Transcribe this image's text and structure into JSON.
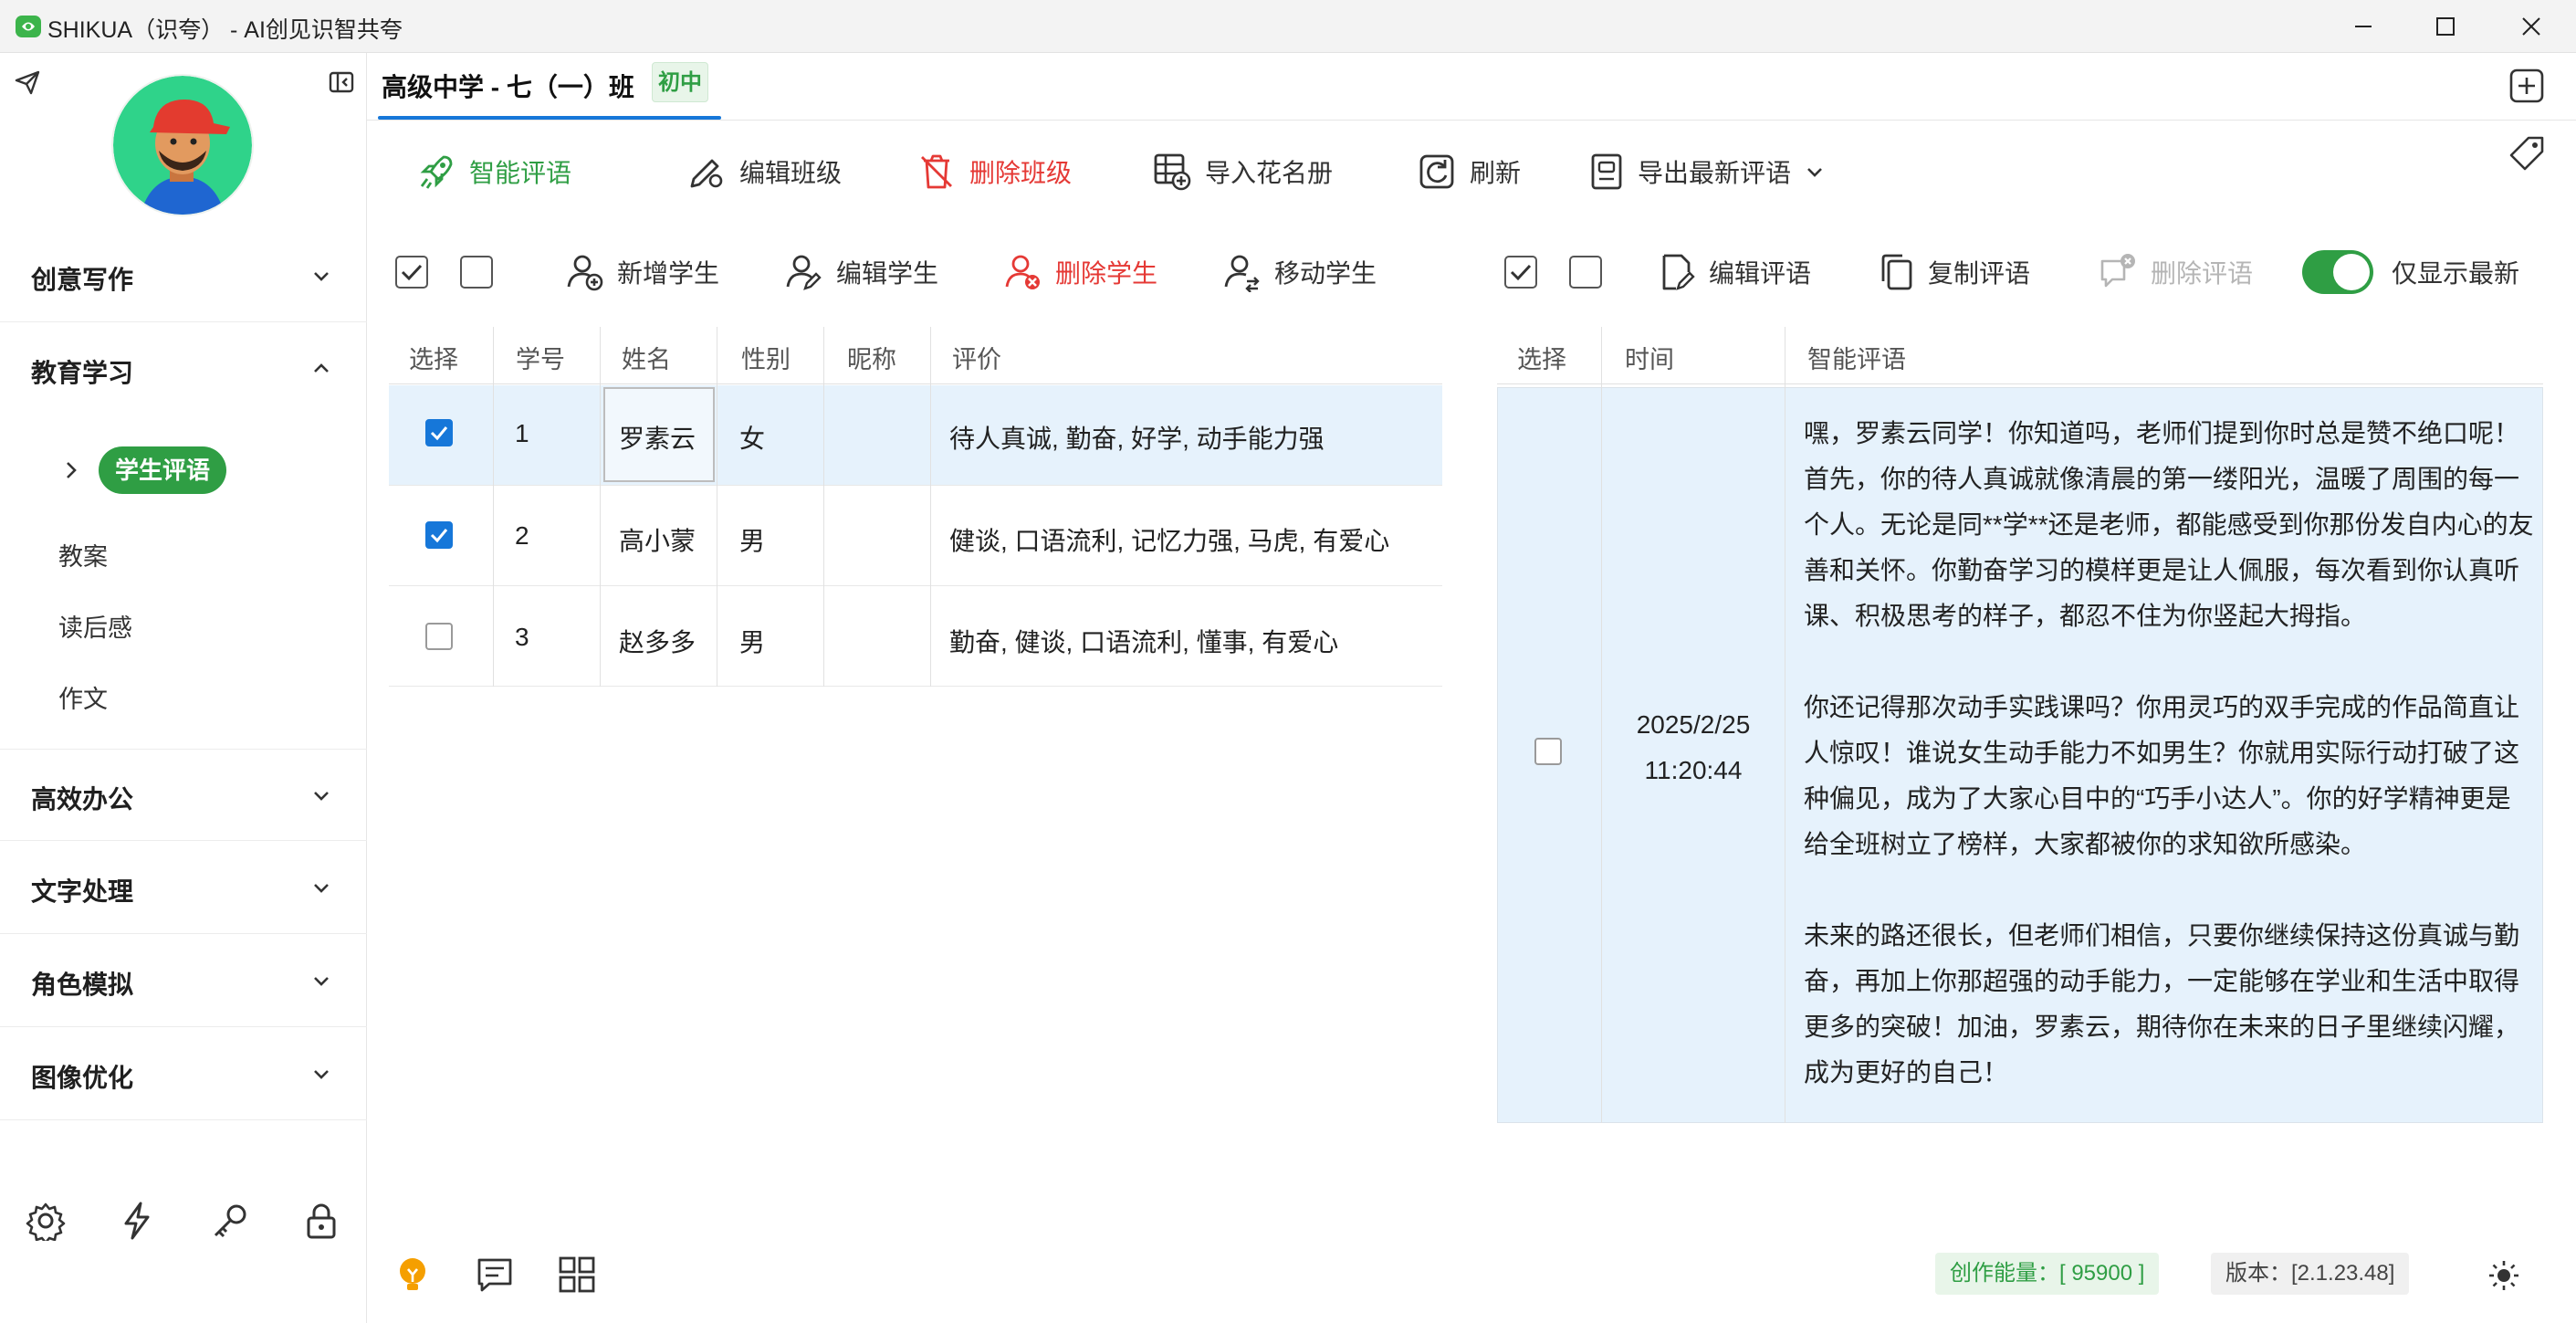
{
  "window": {
    "title": "SHIKUA（识夸） - AI创见识智共夸"
  },
  "sidebar": {
    "groups": [
      {
        "label": "创意写作",
        "expanded": false
      },
      {
        "label": "教育学习",
        "expanded": true
      },
      {
        "label": "高效办公",
        "expanded": false
      },
      {
        "label": "文字处理",
        "expanded": false
      },
      {
        "label": "角色模拟",
        "expanded": false
      },
      {
        "label": "图像优化",
        "expanded": false
      }
    ],
    "active_sub": "学生评语",
    "sub_items": [
      "教案",
      "读后感",
      "作文"
    ]
  },
  "tab": {
    "title": "高级中学 - 七（一）班",
    "badge": "初中"
  },
  "toolbar": {
    "smart_comment": "智能评语",
    "edit_class": "编辑班级",
    "delete_class": "删除班级",
    "import_roster": "导入花名册",
    "refresh": "刷新",
    "export_latest": "导出最新评语"
  },
  "student_toolbar": {
    "add": "新增学生",
    "edit": "编辑学生",
    "delete": "删除学生",
    "move": "移动学生"
  },
  "comment_toolbar": {
    "edit": "编辑评语",
    "copy": "复制评语",
    "delete": "删除评语",
    "latest_only": "仅显示最新",
    "latest_only_on": true
  },
  "students_table": {
    "headers": [
      "选择",
      "学号",
      "姓名",
      "性别",
      "昵称",
      "评价"
    ],
    "rows": [
      {
        "selected": true,
        "id": "1",
        "name": "罗素云",
        "gender": "女",
        "nickname": "",
        "eval": "待人真诚, 勤奋, 好学, 动手能力强"
      },
      {
        "selected": true,
        "id": "2",
        "name": "高小蒙",
        "gender": "男",
        "nickname": "",
        "eval": "健谈, 口语流利, 记忆力强, 马虎, 有爱心"
      },
      {
        "selected": false,
        "id": "3",
        "name": "赵多多",
        "gender": "男",
        "nickname": "",
        "eval": "勤奋, 健谈, 口语流利, 懂事, 有爱心"
      }
    ]
  },
  "comments_table": {
    "headers": [
      "选择",
      "时间",
      "智能评语"
    ],
    "rows": [
      {
        "selected": false,
        "date": "2025/2/25",
        "time": "11:20:44",
        "paragraphs": [
          "嘿，罗素云同学！你知道吗，老师们提到你时总是赞不绝口呢！首先，你的待人真诚就像清晨的第一缕阳光，温暖了周围的每一个人。无论是同**学**还是老师，都能感受到你那份发自内心的友善和关怀。你勤奋学习的模样更是让人佩服，每次看到你认真听课、积极思考的样子，都忍不住为你竖起大拇指。",
          "你还记得那次动手实践课吗？你用灵巧的双手完成的作品简直让人惊叹！谁说女生动手能力不如男生？你就用实际行动打破了这种偏见，成为了大家心目中的“巧手小达人”。你的好学精神更是给全班树立了榜样，大家都被你的求知欲所感染。",
          "未来的路还很长，但老师们相信，只要你继续保持这份真诚与勤奋，再加上你那超强的动手能力，一定能够在学业和生活中取得更多的突破！加油，罗素云，期待你在未来的日子里继续闪耀，成为更好的自己！"
        ]
      }
    ]
  },
  "status": {
    "energy": "创作能量：[ 95900 ]",
    "version": "版本：[2.1.23.48]"
  },
  "icons": [
    "send-icon",
    "collapse-sidebar-icon",
    "settings-icon",
    "lightning-icon",
    "key-icon",
    "lock-icon",
    "lightbulb-icon",
    "chat-icon",
    "grid-icon",
    "theme-sun-icon",
    "new-tab-icon",
    "tag-icon"
  ],
  "colors": {
    "accent_green": "#2f9e44",
    "danger_red": "#e53935",
    "selection_blue": "#1677d9",
    "row_highlight": "#e6f2fc"
  }
}
